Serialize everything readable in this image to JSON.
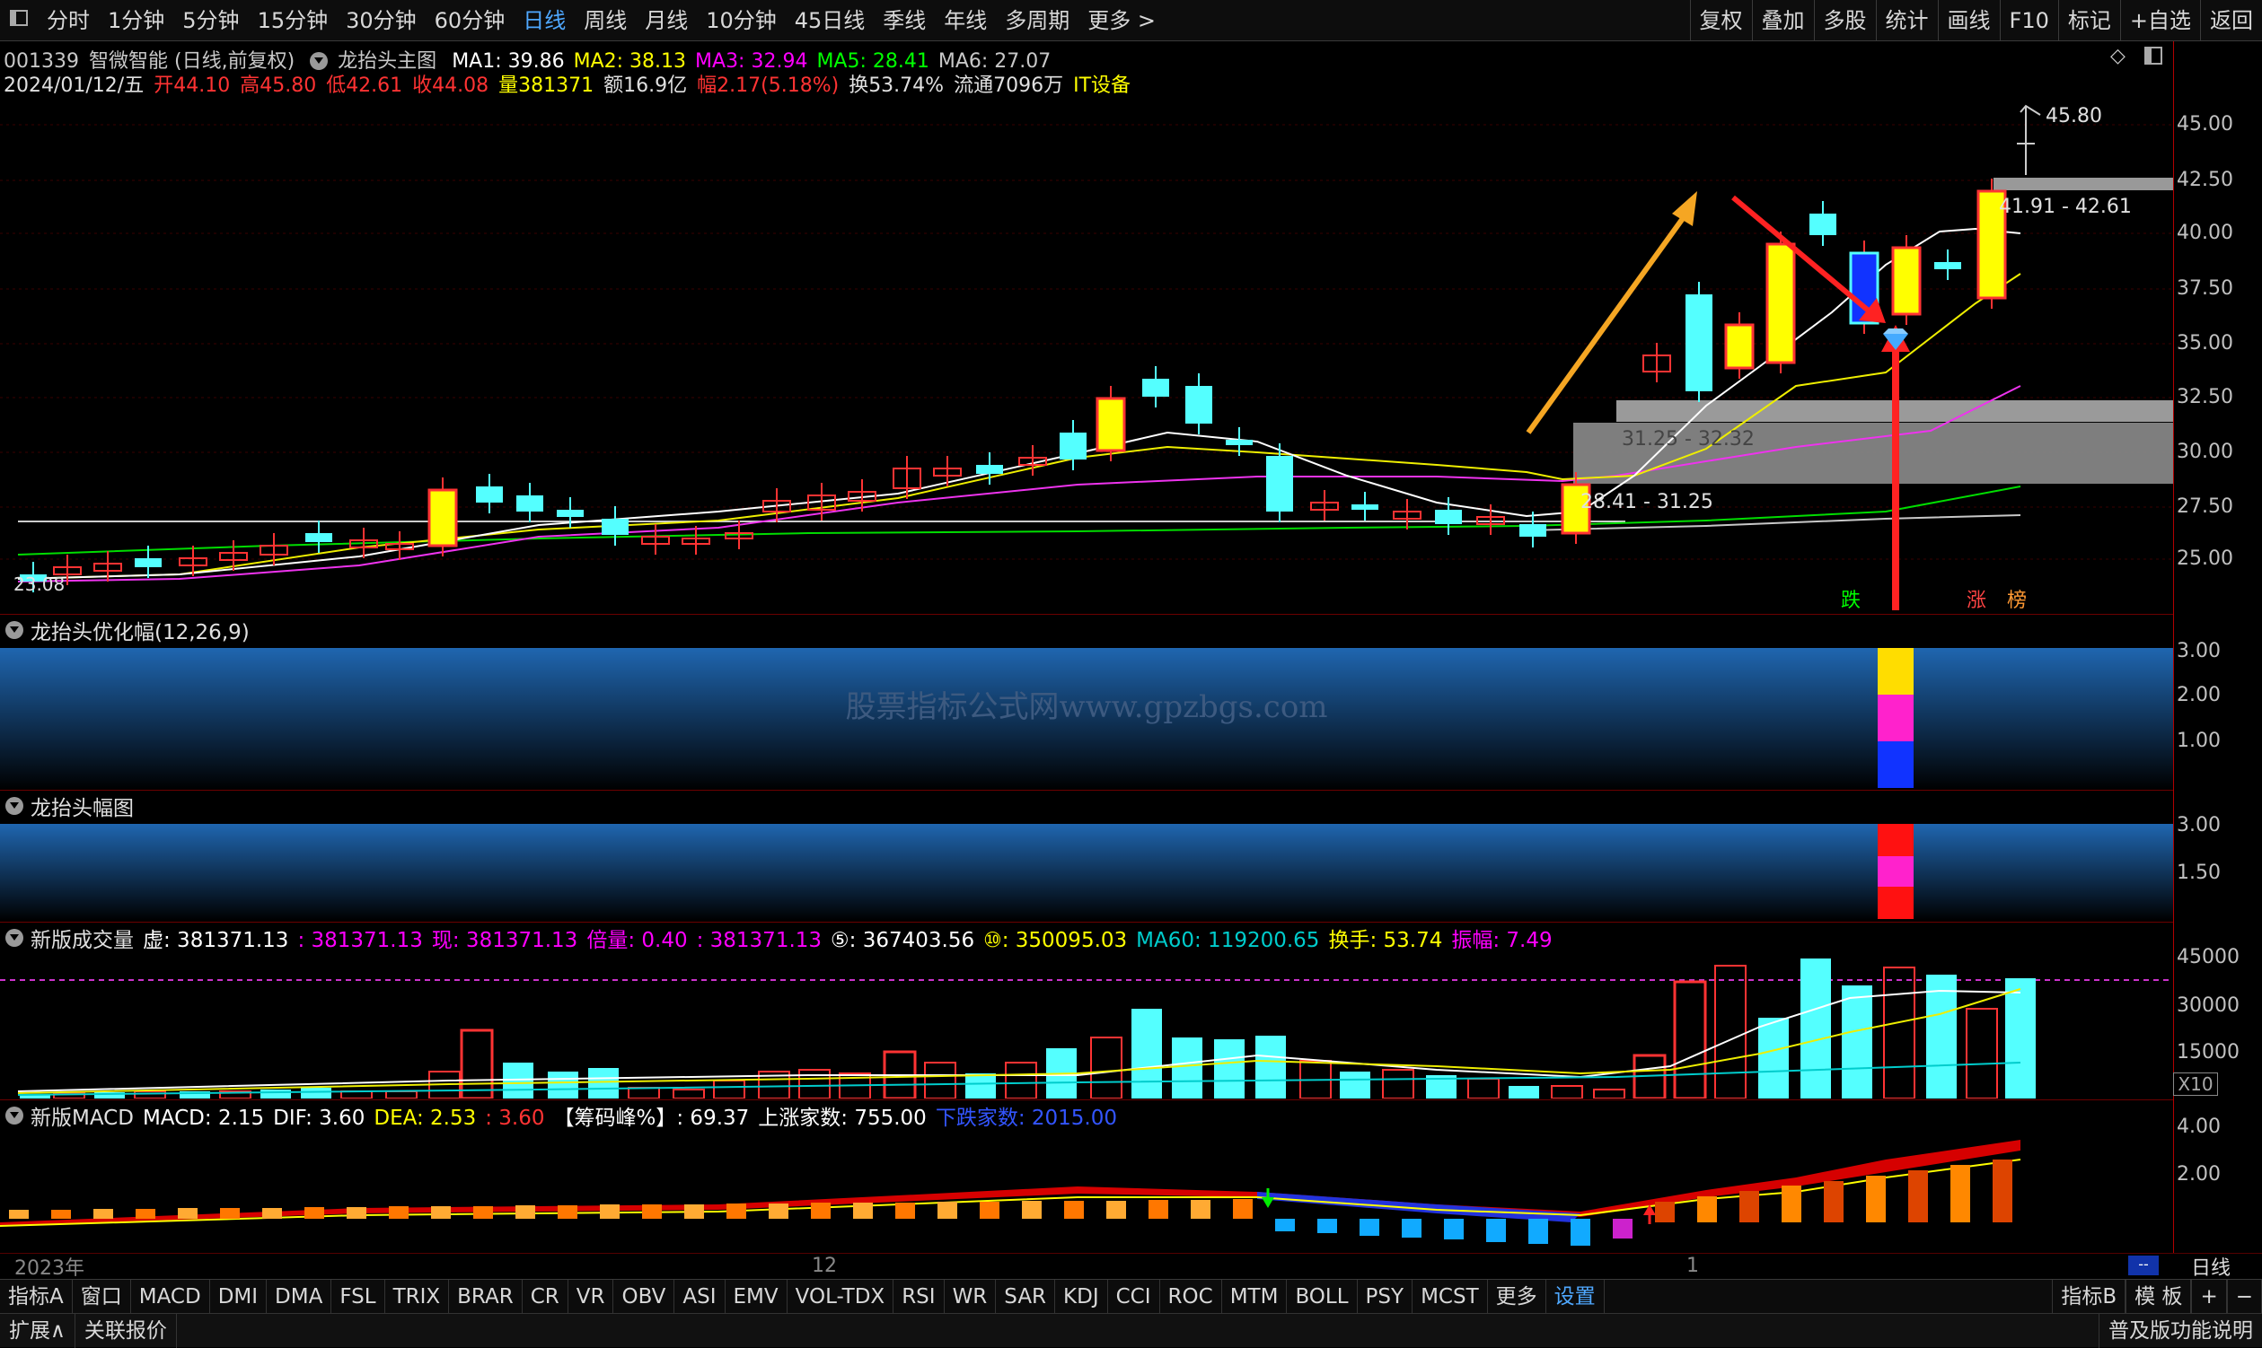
{
  "toolbar": {
    "periods": [
      "分时",
      "1分钟",
      "5分钟",
      "15分钟",
      "30分钟",
      "60分钟",
      "日线",
      "周线",
      "月线",
      "10分钟",
      "45日线",
      "季线",
      "年线",
      "多周期",
      "更多 >"
    ],
    "active_period": "日线",
    "right_buttons": [
      "复权",
      "叠加",
      "多股",
      "统计",
      "画线",
      "F10",
      "标记",
      "+自选",
      "返回"
    ]
  },
  "stock": {
    "code": "001339",
    "name": "智微智能",
    "mode": "(日线,前复权)",
    "indicator": "龙抬头主图",
    "ma": [
      {
        "label": "MA1: 39.86",
        "color": "#ffffff"
      },
      {
        "label": "MA2: 38.13",
        "color": "#ffff00"
      },
      {
        "label": "MA3: 32.94",
        "color": "#ff00ff"
      },
      {
        "label": "MA5: 28.41",
        "color": "#00ff00"
      },
      {
        "label": "MA6: 27.07",
        "color": "#c8c8c8"
      }
    ],
    "date": "2024/01/12/五",
    "open": "开44.10",
    "high": "高45.80",
    "low": "低42.61",
    "close": "收44.08",
    "volume": "量381371",
    "amount": "额16.9亿",
    "change": "幅2.17(5.18%)",
    "turnover": "换53.74%",
    "float": "流通7096万",
    "sector": "IT设备"
  },
  "main_chart": {
    "y_ticks": [
      "45.00",
      "42.50",
      "40.00",
      "37.50",
      "35.00",
      "32.50",
      "30.00",
      "27.50",
      "25.00"
    ],
    "high_label": "45.80",
    "low_label": "23.08",
    "zones": [
      {
        "label": "41.91 - 42.61"
      },
      {
        "label": "31.25 - 32.32"
      },
      {
        "label": "28.41 - 31.25"
      }
    ],
    "markers": [
      {
        "text": "跌",
        "color": "#00ff00"
      },
      {
        "text": "涨",
        "color": "#ff4444"
      },
      {
        "text": "榜",
        "color": "#ff9933"
      }
    ]
  },
  "panel1": {
    "title": "龙抬头优化幅(12,26,9)",
    "y_ticks": [
      "3.00",
      "2.00",
      "1.00"
    ],
    "watermark": "股票指标公式网www.gpzbgs.com"
  },
  "panel2": {
    "title": "龙抬头幅图",
    "y_ticks": [
      "3.00",
      "1.50"
    ]
  },
  "panel3": {
    "title": "新版成交量",
    "values": [
      {
        "text": "虚: 381371.13",
        "color": "#ffffff"
      },
      {
        "text": ": 381371.13",
        "color": "#ff00ff"
      },
      {
        "text": "现: 381371.13",
        "color": "#ff00ff"
      },
      {
        "text": "倍量: 0.40",
        "color": "#ff00ff"
      },
      {
        "text": ": 381371.13",
        "color": "#ff00ff"
      },
      {
        "text": "⑤: 367403.56",
        "color": "#ffffff"
      },
      {
        "text": "⑩: 350095.03",
        "color": "#ffff00"
      },
      {
        "text": "MA60: 119200.65",
        "color": "#00cccc"
      },
      {
        "text": "换手: 53.74",
        "color": "#ffff00"
      },
      {
        "text": "振幅: 7.49",
        "color": "#ff00ff"
      }
    ],
    "y_ticks": [
      "45000",
      "30000",
      "15000"
    ],
    "unit": "X10"
  },
  "panel4": {
    "title": "新版MACD",
    "values": [
      {
        "text": "MACD: 2.15",
        "color": "#ffffff"
      },
      {
        "text": "DIF: 3.60",
        "color": "#ffffff"
      },
      {
        "text": "DEA: 2.53",
        "color": "#ffff00"
      },
      {
        "text": ": 3.60",
        "color": "#ff3333"
      },
      {
        "text": "【筹码峰%】: 69.37",
        "color": "#ffffff"
      },
      {
        "text": "上涨家数: 755.00",
        "color": "#ffffff"
      },
      {
        "text": "下跌家数: 2015.00",
        "color": "#3355ff"
      }
    ],
    "y_ticks": [
      "4.00",
      "2.00"
    ]
  },
  "time_axis": [
    "2023年",
    "12",
    "1"
  ],
  "time_axis_right": "日线",
  "tabs": [
    "指标A",
    "窗口",
    "MACD",
    "DMI",
    "DMA",
    "FSL",
    "TRIX",
    "BRAR",
    "CR",
    "VR",
    "OBV",
    "ASI",
    "EMV",
    "VOL-TDX",
    "RSI",
    "WR",
    "SAR",
    "KDJ",
    "CCI",
    "ROC",
    "MTM",
    "BOLL",
    "PSY",
    "MCST",
    "更多",
    "设置"
  ],
  "tabs_right": [
    "指标B",
    "模 板",
    "+",
    "−"
  ],
  "status": {
    "left": [
      "扩展∧",
      "关联报价"
    ],
    "right": "普及版功能说明"
  },
  "colors": {
    "up": "#ff3333",
    "down": "#54ffff",
    "accent": "#4fa8ff"
  }
}
